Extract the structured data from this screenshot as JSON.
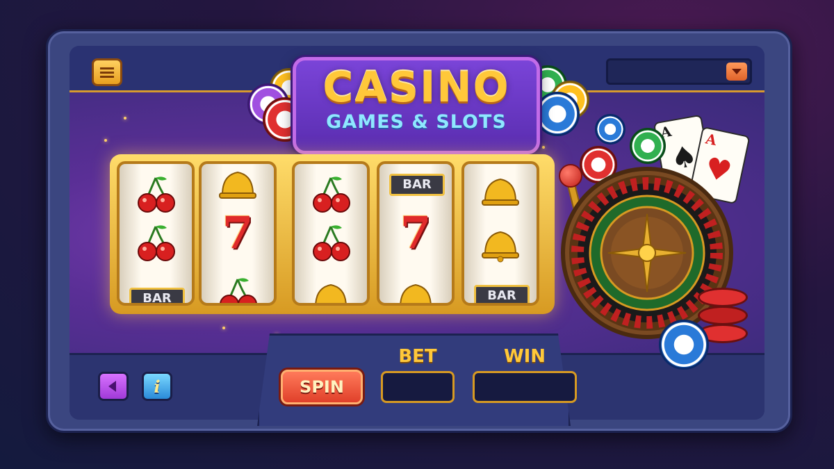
{
  "title": {
    "main": "CASINO",
    "subtitle": "GAMES & SLOTS"
  },
  "menu_button": {
    "icon": "hamburger-menu-icon"
  },
  "dropdown": {
    "value": "",
    "icon": "chevron-down-icon"
  },
  "reels": [
    {
      "symbols": [
        "cherries",
        "cherries",
        "bar"
      ],
      "bar_label": "BAR"
    },
    {
      "symbols": [
        "bell",
        "seven",
        "cherries"
      ],
      "seven_label": "7"
    },
    {
      "symbols": [
        "cherries",
        "cherries",
        "bell"
      ]
    },
    {
      "symbols": [
        "bar",
        "seven",
        "bell"
      ],
      "bar_label": "BAR",
      "seven_label": "7"
    },
    {
      "symbols": [
        "bell",
        "bell",
        "bar"
      ],
      "bar_label": "BAR"
    }
  ],
  "controls": {
    "back_icon": "triangle-left-icon",
    "info_label": "i",
    "spin_label": "SPIN",
    "bet_label": "BET",
    "bet_value": "",
    "win_label": "WIN",
    "win_value": ""
  },
  "cards": [
    {
      "rank": "A",
      "suit": "♠",
      "color": "#1a1a1a"
    },
    {
      "rank": "A",
      "suit": "♥",
      "color": "#d82020"
    }
  ],
  "colors": {
    "gold": "#ffc83a",
    "purple": "#5a2f96",
    "panel_blue": "#2b3270",
    "spin_red": "#e0402a"
  }
}
